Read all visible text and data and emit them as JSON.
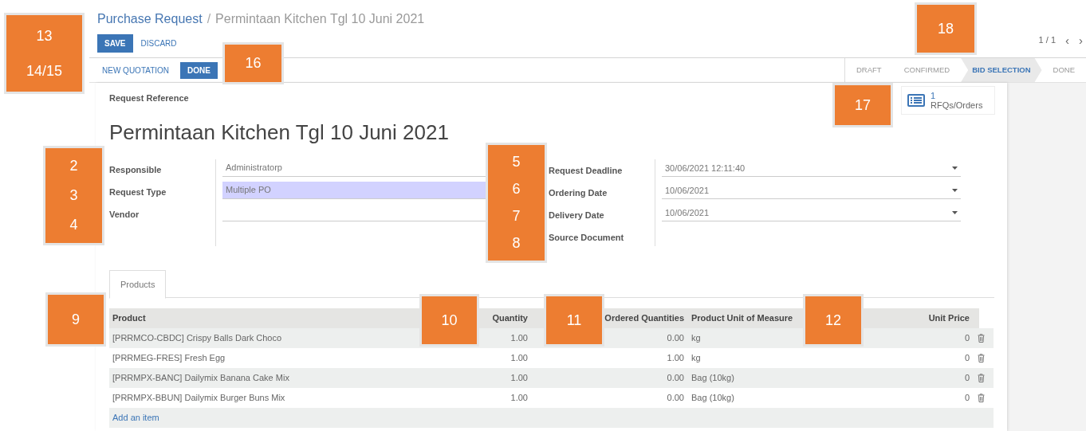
{
  "breadcrumb": {
    "parent": "Purchase Request",
    "separator": "/",
    "current": "Permintaan Kitchen Tgl 10 Juni 2021"
  },
  "buttons": {
    "save": "SAVE",
    "discard": "DISCARD"
  },
  "pager": {
    "text": "1 / 1",
    "prev": "‹",
    "next": "›"
  },
  "actions": [
    {
      "label": "NEW QUOTATION",
      "kind": "link"
    },
    {
      "label": "DONE",
      "kind": "primary"
    }
  ],
  "stages": [
    {
      "label": "DRAFT",
      "selected": false
    },
    {
      "label": "CONFIRMED",
      "selected": false
    },
    {
      "label": "BID SELECTION",
      "selected": true
    },
    {
      "label": "DONE",
      "selected": false
    }
  ],
  "smart_button": {
    "count": "1",
    "label": "RFQs/Orders"
  },
  "reference_label": "Request Reference",
  "title": "Permintaan Kitchen Tgl 10 Juni 2021",
  "left_fields": [
    {
      "label": "Responsible",
      "value": "Administratorp",
      "highlighted": false
    },
    {
      "label": "Request Type",
      "value": "Multiple PO",
      "highlighted": true
    },
    {
      "label": "Vendor",
      "highlighted": false
    }
  ],
  "right_fields": [
    {
      "label": "Request Deadline",
      "value": "30/06/2021 12:11:40",
      "kind": "date"
    },
    {
      "label": "Ordering Date",
      "value": "10/06/2021",
      "kind": "date"
    },
    {
      "label": "Delivery Date",
      "value": "10/06/2021",
      "kind": "date"
    },
    {
      "label": "Source Document",
      "kind": "text"
    }
  ],
  "tabs": [
    {
      "label": "Products",
      "selected": true
    }
  ],
  "table": {
    "columns": [
      "Product",
      "Quantity",
      "Ordered Quantities",
      "Product Unit of Measure",
      "Unit Price"
    ],
    "rows": [
      {
        "product": "[PRRMCO-CBDC] Crispy Balls Dark Choco",
        "quantity": "1.00",
        "ordered": "0.00",
        "uom": "kg",
        "price": "0"
      },
      {
        "product": "[PRRMEG-FRES] Fresh Egg",
        "quantity": "1.00",
        "ordered": "1.00",
        "uom": "kg",
        "price": "0"
      },
      {
        "product": "[PRRMPX-BANC] Dailymix Banana Cake Mix",
        "quantity": "1.00",
        "ordered": "0.00",
        "uom": "Bag (10kg)",
        "price": "0"
      },
      {
        "product": "[PRRMPX-BBUN] Dailymix Burger Buns Mix",
        "quantity": "1.00",
        "ordered": "0.00",
        "uom": "Bag (10kg)",
        "price": "0"
      }
    ],
    "add_item": "Add an item"
  },
  "callouts": [
    {
      "labels": [
        "13",
        "14/15"
      ]
    },
    {
      "labels": [
        "16"
      ]
    },
    {
      "labels": [
        "18"
      ]
    },
    {
      "labels": [
        "17"
      ]
    },
    {
      "labels": [
        "2",
        "3",
        "4"
      ]
    },
    {
      "labels": [
        "5",
        "6",
        "7",
        "8"
      ]
    },
    {
      "labels": [
        "9"
      ]
    },
    {
      "labels": [
        "10"
      ]
    },
    {
      "labels": [
        "11"
      ]
    },
    {
      "labels": [
        "12"
      ]
    }
  ]
}
